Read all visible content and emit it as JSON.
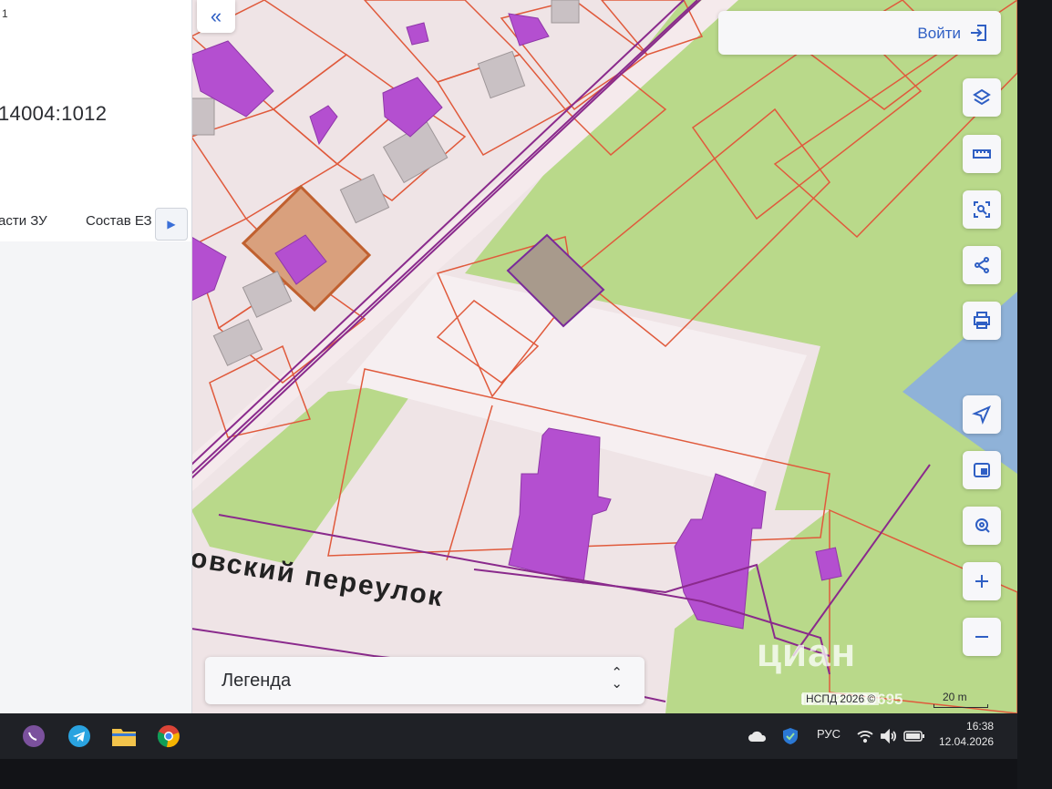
{
  "panel": {
    "top_fragment": "1",
    "cadastral_number": "14004:1012",
    "tab_parts": "асти ЗУ",
    "tab_composition": "Состав ЕЗ"
  },
  "map": {
    "street_label": "овский переулок",
    "copyright": "НСПД 2026 ©",
    "scale": "20 m",
    "watermark": "циан",
    "watermark_id": "ID: 326889695"
  },
  "header": {
    "login_label": "Войти"
  },
  "tools": [
    "layers-icon",
    "ruler-icon",
    "area-select-icon",
    "share-icon",
    "print-icon",
    "locate-icon",
    "minimap-icon",
    "search-location-icon",
    "zoom-in-icon",
    "zoom-out-icon"
  ],
  "legend": {
    "label": "Легенда"
  },
  "taskbar": {
    "lang": "РУС",
    "time": "16:38",
    "date": "12.04.2026"
  },
  "colors": {
    "parcel_border": "#e05a3c",
    "building": "#b44fd0",
    "green_zone": "#b9d98a",
    "selected_parcel": "#c9855a",
    "utility_line": "#8a2a8c",
    "accent": "#2f5fc4"
  }
}
